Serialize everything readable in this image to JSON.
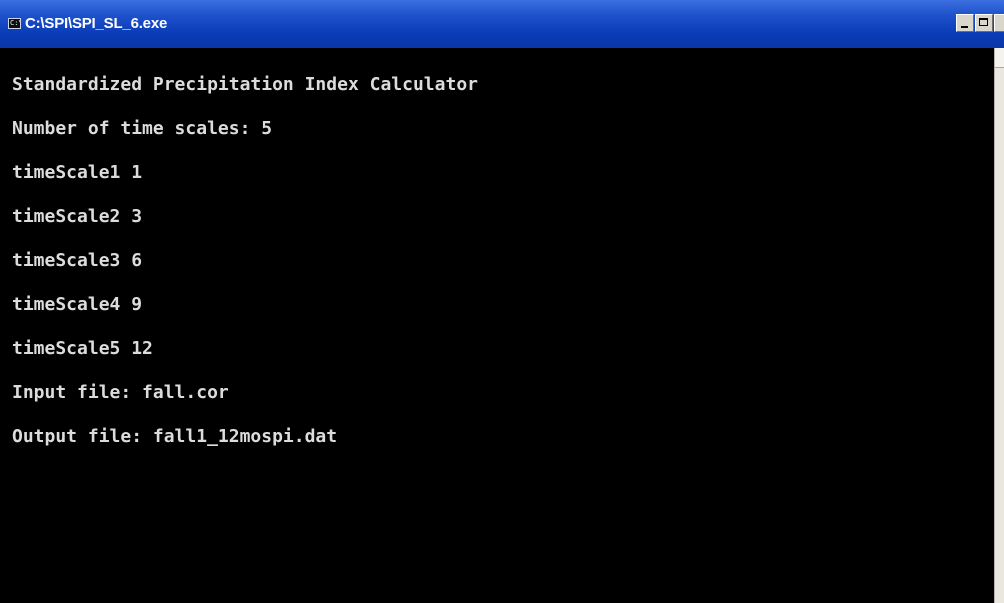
{
  "window": {
    "title": "C:\\SPI\\SPI_SL_6.exe",
    "icon": "console-window-icon",
    "icon_text": "C:\\",
    "controls": [
      "minimize-icon",
      "maximize-icon",
      "close-icon"
    ]
  },
  "console": {
    "lines": [
      "Standardized Precipitation Index Calculator",
      "Number of time scales: 5",
      "timeScale1 1",
      "timeScale2 3",
      "timeScale3 6",
      "timeScale4 9",
      "timeScale5 12",
      "Input file: fall.cor",
      "Output file: fall1_12mospi.dat"
    ]
  },
  "colors": {
    "titlebar": "#0a3cb8",
    "console_background": "#000000",
    "console_text": "#dcdcdc"
  }
}
